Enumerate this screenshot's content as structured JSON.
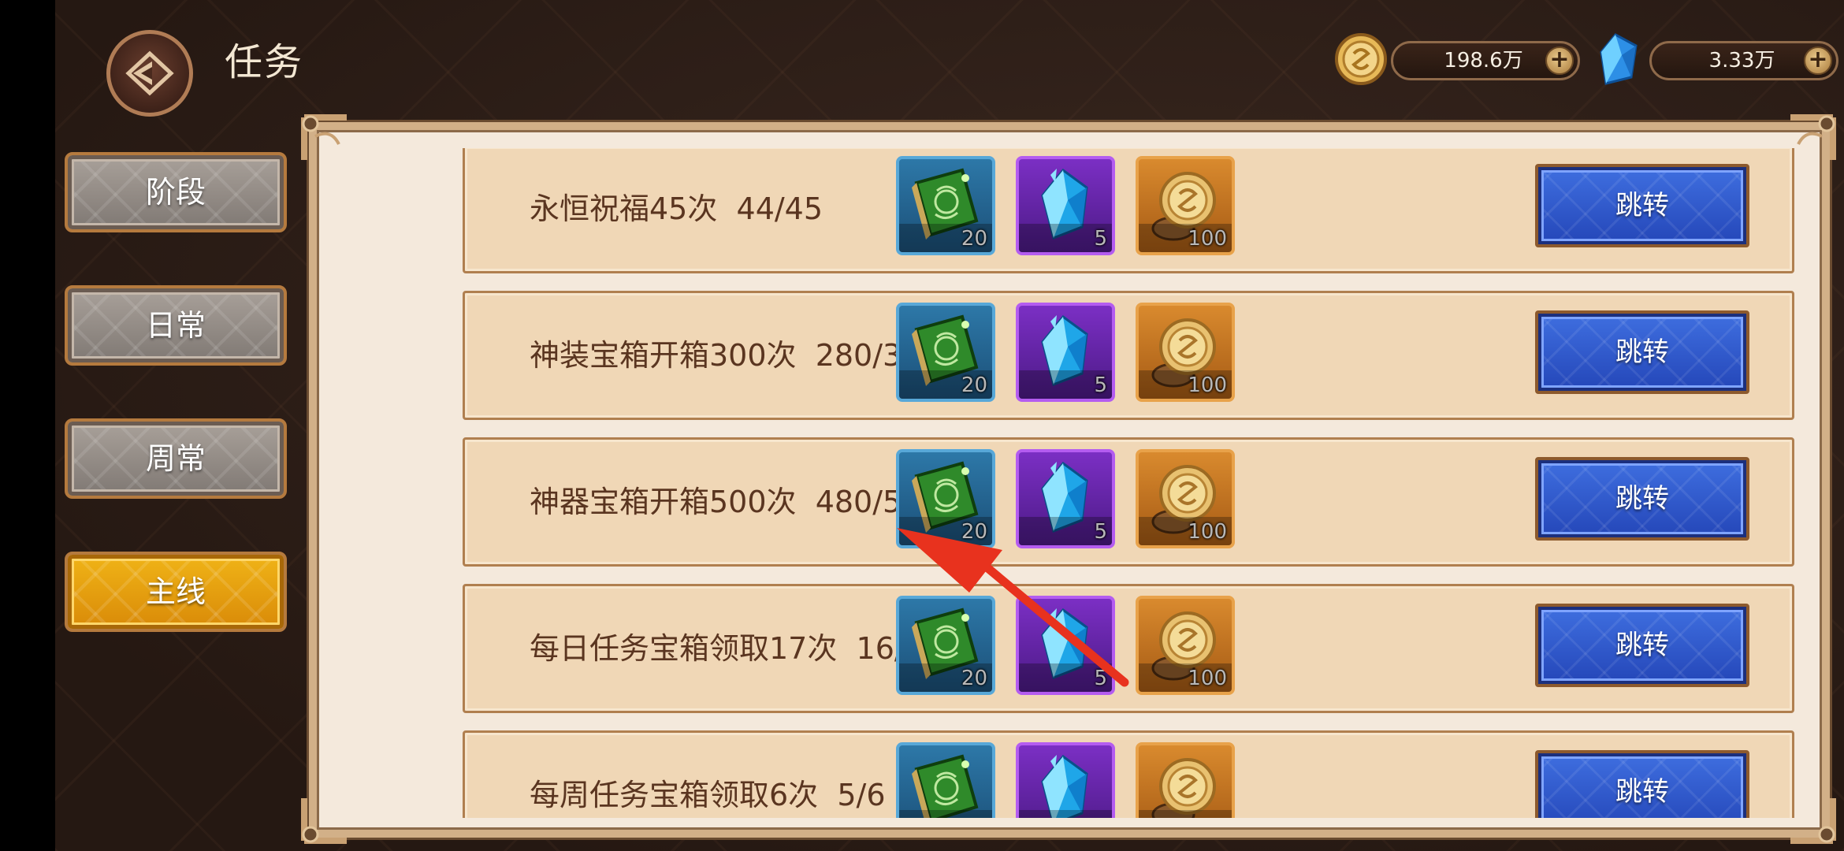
{
  "header": {
    "title": "任务",
    "gold": {
      "icon": "gold-coin-icon",
      "value": "198.6万",
      "plus": "+"
    },
    "crystal": {
      "icon": "blue-crystal-icon",
      "value": "3.33万",
      "plus": "+"
    }
  },
  "tabs": [
    {
      "label": "阶段",
      "active": false
    },
    {
      "label": "日常",
      "active": false
    },
    {
      "label": "周常",
      "active": false
    },
    {
      "label": "主线",
      "active": true
    }
  ],
  "tasks": [
    {
      "text": "永恒祝福45次  44/45",
      "button": "跳转",
      "rewards": [
        {
          "icon": "green-book-icon",
          "count": "20"
        },
        {
          "icon": "blue-crystal-icon",
          "count": "5"
        },
        {
          "icon": "gold-coin-icon",
          "count": "100"
        }
      ]
    },
    {
      "text": "神装宝箱开箱300次  280/300",
      "button": "跳转",
      "rewards": [
        {
          "icon": "green-book-icon",
          "count": "20"
        },
        {
          "icon": "blue-crystal-icon",
          "count": "5"
        },
        {
          "icon": "gold-coin-icon",
          "count": "100"
        }
      ]
    },
    {
      "text": "神器宝箱开箱500次  480/500",
      "button": "跳转",
      "rewards": [
        {
          "icon": "green-book-icon",
          "count": "20"
        },
        {
          "icon": "blue-crystal-icon",
          "count": "5"
        },
        {
          "icon": "gold-coin-icon",
          "count": "100"
        }
      ]
    },
    {
      "text": "每日任务宝箱领取17次  16/17",
      "button": "跳转",
      "rewards": [
        {
          "icon": "green-book-icon",
          "count": "20"
        },
        {
          "icon": "blue-crystal-icon",
          "count": "5"
        },
        {
          "icon": "gold-coin-icon",
          "count": "100"
        }
      ]
    },
    {
      "text": "每周任务宝箱领取6次  5/6",
      "button": "跳转",
      "rewards": [
        {
          "icon": "green-book-icon",
          "count": ""
        },
        {
          "icon": "blue-crystal-icon",
          "count": ""
        },
        {
          "icon": "gold-coin-icon",
          "count": ""
        }
      ]
    }
  ],
  "colors": {
    "annotation_arrow": "#e8321e",
    "active_tab": "#e9a410",
    "jump_button": "#2f57cc"
  }
}
